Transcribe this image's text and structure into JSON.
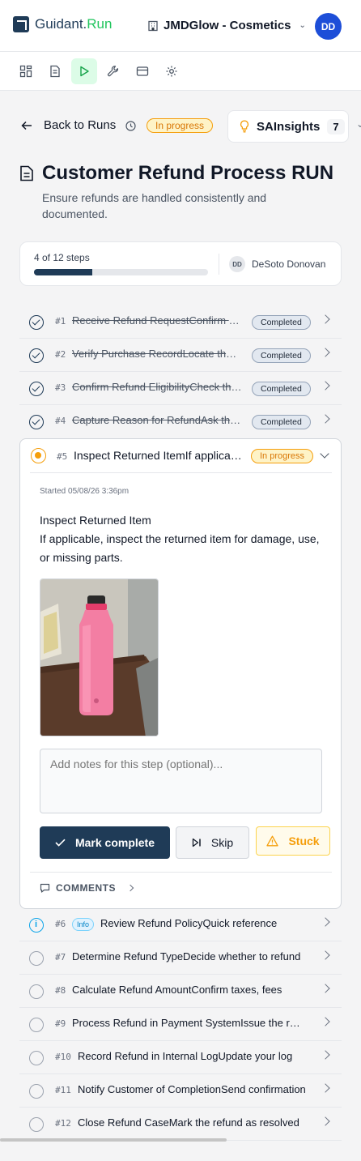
{
  "brand": {
    "name": "Guidant.",
    "accent": "Run",
    "color": "#1f3b57",
    "accent_color": "#22c55e"
  },
  "org": {
    "name": "JMDGlow - Cosmetics",
    "icon": "building-icon"
  },
  "user": {
    "initials": "DD"
  },
  "toolbar": {
    "items": [
      "grid-icon",
      "document-icon",
      "play-icon",
      "wrench-icon",
      "card-icon",
      "gear-icon"
    ],
    "active": "play-icon"
  },
  "run": {
    "back_label": "Back to Runs",
    "status": "In progress",
    "insights_label": "SAInsights",
    "insights_count": "7",
    "title": "Customer Refund Process RUN",
    "subtitle": "Ensure refunds are handled consistently and documented."
  },
  "progress": {
    "label": "4 of 12 steps",
    "fraction": 0.333,
    "assignee_initials": "DD",
    "assignee_name": "DeSoto Donovan"
  },
  "steps": [
    {
      "num": "#1",
      "name": "Receive Refund RequestConfirm the request details",
      "status": "Completed"
    },
    {
      "num": "#2",
      "name": "Verify Purchase RecordLocate the original order",
      "status": "Completed"
    },
    {
      "num": "#3",
      "name": "Confirm Refund EligibilityCheck the refund policy",
      "status": "Completed"
    },
    {
      "num": "#4",
      "name": "Capture Reason for RefundAsk the customer",
      "status": "Completed"
    },
    {
      "num": "#5",
      "name": "Inspect Returned ItemIf applicable, inspect the item",
      "status": "In progress"
    },
    {
      "num": "#6",
      "name": "Review Refund PolicyQuick reference",
      "status": "Info"
    },
    {
      "num": "#7",
      "name": "Determine Refund TypeDecide whether to refund",
      "status": ""
    },
    {
      "num": "#8",
      "name": "Calculate Refund AmountConfirm taxes, fees",
      "status": ""
    },
    {
      "num": "#9",
      "name": "Process Refund in Payment SystemIssue the refund",
      "status": ""
    },
    {
      "num": "#10",
      "name": "Record Refund in Internal LogUpdate your log",
      "status": ""
    },
    {
      "num": "#11",
      "name": "Notify Customer of CompletionSend confirmation",
      "status": ""
    },
    {
      "num": "#12",
      "name": "Close Refund CaseMark the refund as resolved",
      "status": ""
    }
  ],
  "active_step": {
    "started": "Started 05/08/26 3:36pm",
    "detail_title": "Inspect Returned Item",
    "detail_body": "If applicable, inspect the returned item for damage, use, or missing parts.",
    "notes_placeholder": "Add notes for this step (optional)...",
    "complete_label": "Mark complete",
    "skip_label": "Skip",
    "stuck_label": "Stuck",
    "comments_label": "COMMENTS"
  },
  "colors": {
    "primary": "#1f3b57",
    "warning": "#f59e0b",
    "info": "#0ea5e9"
  }
}
